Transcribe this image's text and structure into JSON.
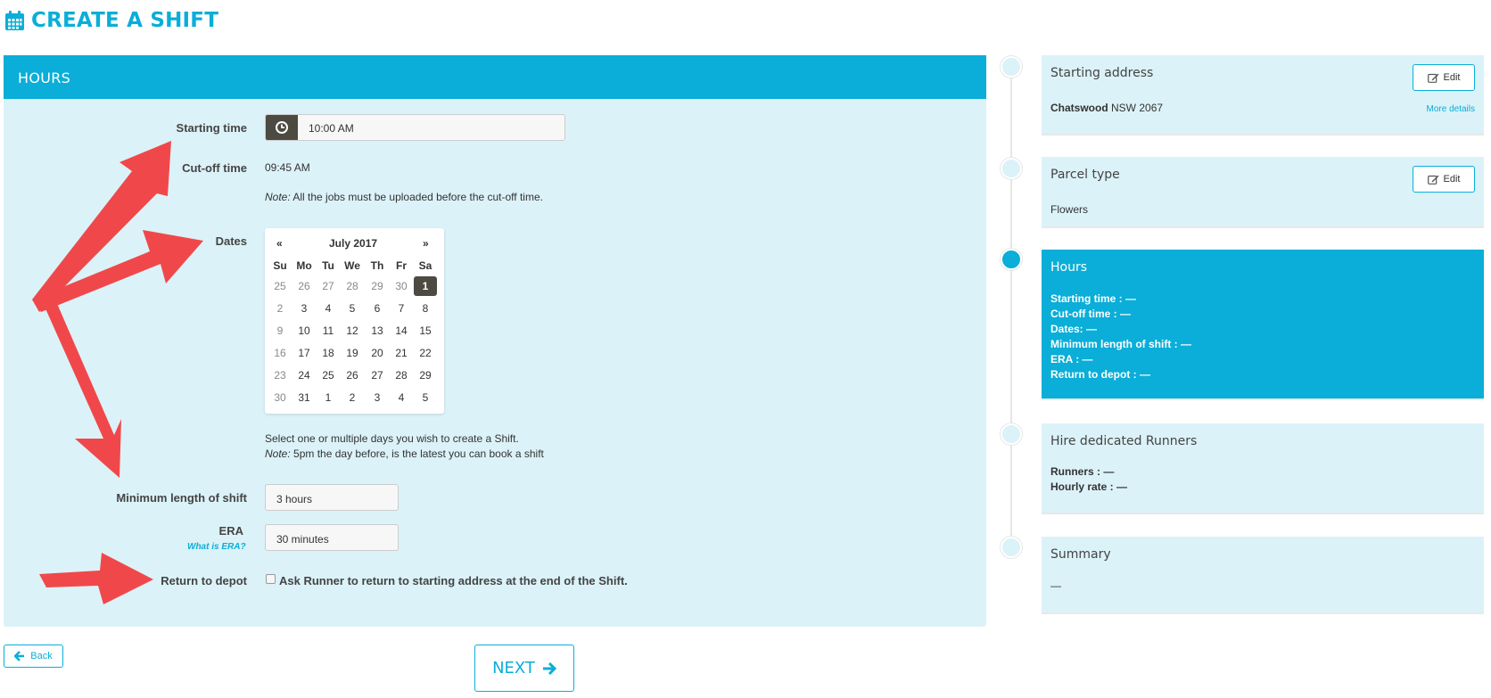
{
  "header": {
    "title": "CREATE A SHIFT",
    "icon": "calendar-icon"
  },
  "panel": {
    "title": "HOURS"
  },
  "form": {
    "starting_time_label": "Starting time",
    "starting_time_value": "10:00 AM",
    "cutoff_label": "Cut-off time",
    "cutoff_value": "09:45 AM",
    "cutoff_note_prefix": "Note:",
    "cutoff_note": "All the jobs must be uploaded before the cut-off time.",
    "dates_label": "Dates",
    "dates_help": "Select one or multiple days you wish to create a Shift.",
    "dates_note_prefix": "Note:",
    "dates_note": "5pm the day before, is the latest you can book a shift",
    "min_length_label": "Minimum length of shift",
    "min_length_value": "3 hours",
    "era_label": "ERA",
    "era_link": "What is ERA?",
    "era_value": "30 minutes",
    "return_label": "Return to depot",
    "return_checkbox_label": "Ask Runner to return to starting address at the end of the Shift.",
    "return_checked": false
  },
  "calendar": {
    "prev": "«",
    "next": "»",
    "month": "July 2017",
    "weekdays": [
      "Su",
      "Mo",
      "Tu",
      "We",
      "Th",
      "Fr",
      "Sa"
    ],
    "weeks": [
      [
        "25",
        "26",
        "27",
        "28",
        "29",
        "30",
        "1"
      ],
      [
        "2",
        "3",
        "4",
        "5",
        "6",
        "7",
        "8"
      ],
      [
        "9",
        "10",
        "11",
        "12",
        "13",
        "14",
        "15"
      ],
      [
        "16",
        "17",
        "18",
        "19",
        "20",
        "21",
        "22"
      ],
      [
        "23",
        "24",
        "25",
        "26",
        "27",
        "28",
        "29"
      ],
      [
        "30",
        "31",
        "1",
        "2",
        "3",
        "4",
        "5"
      ]
    ],
    "selected": "1"
  },
  "buttons": {
    "back": "Back",
    "next": "NEXT"
  },
  "steps": {
    "starting_address": {
      "title": "Starting address",
      "edit": "Edit",
      "address_bold": "Chatswood",
      "address_rest": "NSW 2067",
      "more": "More details"
    },
    "parcel_type": {
      "title": "Parcel type",
      "edit": "Edit",
      "value": "Flowers"
    },
    "hours": {
      "title": "Hours",
      "lines": [
        "Starting time : —",
        "Cut-off time : —",
        "Dates: —",
        "Minimum length of shift : —",
        "ERA : —",
        "Return to depot : —"
      ]
    },
    "runners": {
      "title": "Hire dedicated Runners",
      "lines": [
        "Runners : —",
        "Hourly rate : —"
      ]
    },
    "summary": {
      "title": "Summary",
      "value": "—"
    }
  },
  "colors": {
    "accent": "#0aaed8",
    "panel_bg": "#dbf2f8",
    "dark": "#4d4a42",
    "annotation_arrow": "#f0484a"
  }
}
